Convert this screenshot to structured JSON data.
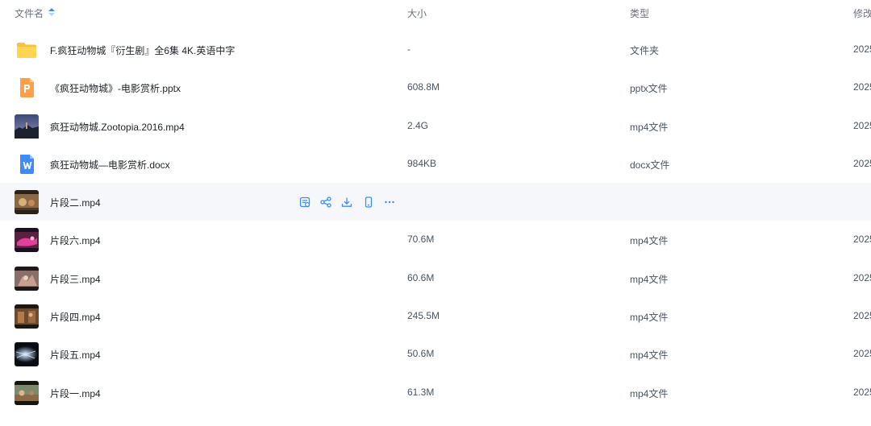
{
  "header": {
    "name_label": "文件名",
    "size_label": "大小",
    "type_label": "类型",
    "modified_label": "修改"
  },
  "accent_color": "#3d8bff",
  "rows": [
    {
      "name": "F.疯狂动物城『衍生剧』全6集 4K.英语中字",
      "size": "-",
      "type": "文件夹",
      "date": "2025",
      "icon": "folder-icon"
    },
    {
      "name": "《疯狂动物城》-电影赏析.pptx",
      "size": "608.8M",
      "type": "pptx文件",
      "date": "2025",
      "icon": "pptx-file-icon"
    },
    {
      "name": "疯狂动物城.Zootopia.2016.mp4",
      "size": "2.4G",
      "type": "mp4文件",
      "date": "2025",
      "icon": "video-thumbnail"
    },
    {
      "name": "疯狂动物城—电影赏析.docx",
      "size": "984KB",
      "type": "docx文件",
      "date": "2025",
      "icon": "docx-file-icon"
    },
    {
      "name": "片段二.mp4",
      "size": "",
      "type": "",
      "date": "",
      "icon": "video-thumbnail",
      "hovered": true
    },
    {
      "name": "片段六.mp4",
      "size": "70.6M",
      "type": "mp4文件",
      "date": "2025",
      "icon": "video-thumbnail"
    },
    {
      "name": "片段三.mp4",
      "size": "60.6M",
      "type": "mp4文件",
      "date": "2025",
      "icon": "video-thumbnail"
    },
    {
      "name": "片段四.mp4",
      "size": "245.5M",
      "type": "mp4文件",
      "date": "2025",
      "icon": "video-thumbnail"
    },
    {
      "name": "片段五.mp4",
      "size": "50.6M",
      "type": "mp4文件",
      "date": "2025",
      "icon": "video-thumbnail"
    },
    {
      "name": "片段一.mp4",
      "size": "61.3M",
      "type": "mp4文件",
      "date": "2025",
      "icon": "video-thumbnail"
    }
  ],
  "hover_actions": [
    "save-icon",
    "share-icon",
    "download-icon",
    "phone-icon",
    "more-icon"
  ]
}
